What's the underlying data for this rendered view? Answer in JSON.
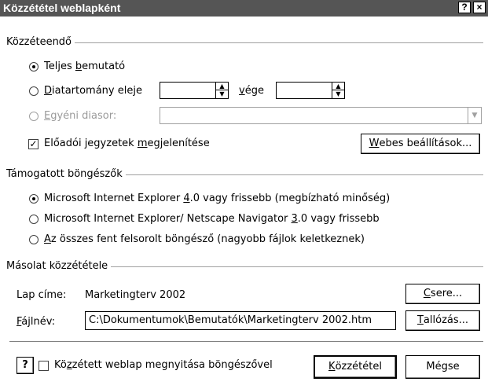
{
  "title": "Közzététel weblapként",
  "titlebar": {
    "help": "?",
    "close": "×"
  },
  "publish_group": {
    "label": "Közzéteendő",
    "complete": {
      "pre": "Teljes ",
      "u": "b",
      "post": "emutató"
    },
    "range": {
      "pre": "",
      "u": "D",
      "post": "iatartomány eleje"
    },
    "range_end": {
      "pre": "",
      "u": "v",
      "post": "ége"
    },
    "range_start_value": "",
    "range_end_value": "",
    "custom": {
      "pre": "",
      "u": "E",
      "post": "gyéni diasor:"
    },
    "custom_value": "",
    "notes": {
      "pre": "Előadói jegyzetek ",
      "u": "m",
      "post": "egjelenítése"
    },
    "notes_checked": true,
    "web_options": {
      "pre": "",
      "u": "W",
      "post": "ebes beállítások..."
    }
  },
  "browsers_group": {
    "label": "Támogatott böngészők",
    "ie4": {
      "pre": "Microsoft Internet Explorer ",
      "u": "4",
      "post": ".0 vagy frissebb (megbízható minőség)"
    },
    "ie3": {
      "pre": "Microsoft Internet Explorer/ Netscape Navigator ",
      "u": "3",
      "post": ".0 vagy frissebb"
    },
    "all": {
      "pre": "",
      "u": "A",
      "post": "z összes fent felsorolt böngésző (nagyobb fájlok keletkeznek)"
    },
    "selected": "ie4"
  },
  "copy_group": {
    "label": "Másolat közzététele",
    "page_title_label": "Lap címe:",
    "page_title_value": "Marketingterv 2002",
    "change_button": {
      "pre": "",
      "u": "C",
      "post": "sere..."
    },
    "filename_label": {
      "pre": "",
      "u": "F",
      "post": "ájlnév:"
    },
    "filename_value": "C:\\Dokumentumok\\Bemutatók\\Marketingterv 2002.htm",
    "browse_button": {
      "pre": "",
      "u": "T",
      "post": "allózás..."
    }
  },
  "footer": {
    "help_icon": "?",
    "open_checkbox": {
      "pre": "Kö",
      "u": "z",
      "post": "zétett weblap megnyitása böngészővel"
    },
    "open_checked": false,
    "publish_button": {
      "pre": "",
      "u": "K",
      "post": "özzététel"
    },
    "cancel_button": "Mégse"
  },
  "colors": {
    "titlebar": "#555555",
    "background": "#ffffff"
  }
}
